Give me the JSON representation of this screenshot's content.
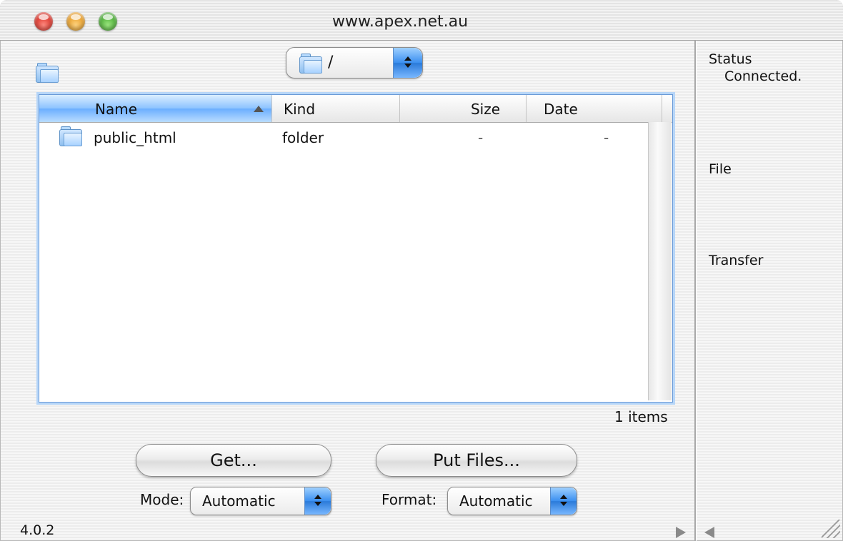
{
  "window": {
    "title": "www.apex.net.au"
  },
  "path_popup": {
    "value": "/"
  },
  "file_list": {
    "columns": [
      "Name",
      "Kind",
      "Size",
      "Date"
    ],
    "sort_column": "Name",
    "rows": [
      {
        "name": "public_html",
        "kind": "folder",
        "size": "-",
        "date": "-",
        "icon": "folder-icon"
      }
    ],
    "items_count": "1 items"
  },
  "actions": {
    "get_label": "Get...",
    "put_label": "Put Files..."
  },
  "options": {
    "mode_label": "Mode:",
    "mode_value": "Automatic",
    "format_label": "Format:",
    "format_value": "Automatic"
  },
  "info_panel": {
    "status_label": "Status",
    "status_value": "Connected.",
    "file_label": "File",
    "transfer_label": "Transfer"
  },
  "footer": {
    "version": "4.0.2"
  },
  "colors": {
    "selection_blue": "#6aaeff",
    "close": "#d4251b",
    "minimize": "#e3941a",
    "zoom": "#3ea22a"
  }
}
